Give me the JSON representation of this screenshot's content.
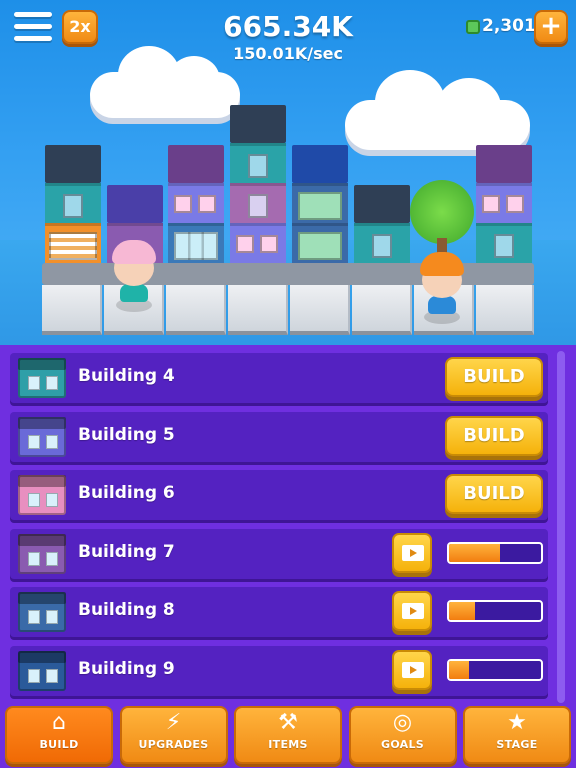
{
  "header": {
    "menu_icon": "hamburger-menu-icon",
    "boost_label": "2x",
    "total": "665.34K",
    "rate": "150.01K/sec",
    "gems": "2,301",
    "add_label": "+",
    "gem_icon": "green-gem-icon"
  },
  "buildings_list": [
    {
      "name": "Building 4",
      "action": "BUILD",
      "color": "#2f9fa8"
    },
    {
      "name": "Building 5",
      "action": "BUILD",
      "color": "#6a6ad8"
    },
    {
      "name": "Building 6",
      "action": "BUILD",
      "color": "#e88fc0"
    },
    {
      "name": "Building 7",
      "action": "video",
      "progress": 0.55,
      "color": "#8a5bb0"
    },
    {
      "name": "Building 8",
      "action": "video",
      "progress": 0.28,
      "color": "#3a6aa8"
    },
    {
      "name": "Building 9",
      "action": "video",
      "progress": 0.22,
      "color": "#2a5a9a"
    }
  ],
  "tabs": [
    {
      "label": "BUILD",
      "icon": "house-icon",
      "glyph": "⌂",
      "active": true
    },
    {
      "label": "UPGRADES",
      "icon": "lightning-icon",
      "glyph": "⚡",
      "active": false
    },
    {
      "label": "ITEMS",
      "icon": "hammer-icon",
      "glyph": "⚒",
      "active": false
    },
    {
      "label": "GOALS",
      "icon": "target-icon",
      "glyph": "◎",
      "active": false
    },
    {
      "label": "STAGE",
      "icon": "star-icon",
      "glyph": "★",
      "active": false
    }
  ],
  "colors": {
    "sky": "#1e8fe8",
    "panel": "#6f2fe0",
    "row": "#5422c1",
    "build_button": "#f5b20b",
    "tab": "#f08a14"
  }
}
